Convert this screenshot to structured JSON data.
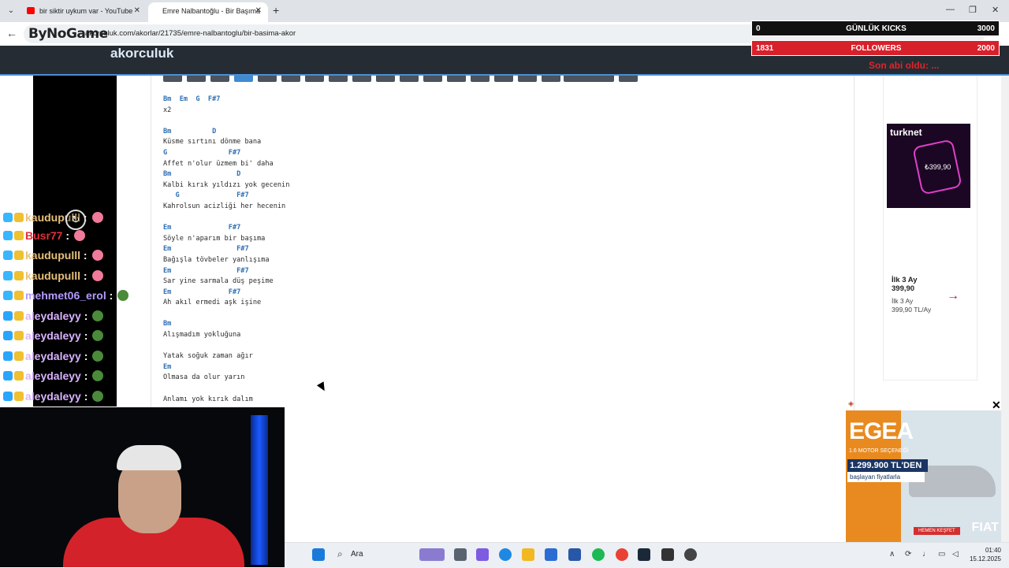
{
  "browser": {
    "tabs": [
      {
        "title": "bir siktir uykum var - YouTube",
        "favicon": "youtube-icon"
      },
      {
        "title": "Emre Nalbantoğlu - Bir Başıma",
        "favicon": "site-icon"
      }
    ],
    "url": "akorculuk.com/akorlar/21735/emre-nalbantoglu/bir-basima-akor"
  },
  "stream_logo": "ByNoGame",
  "site": {
    "name": "akorculuk",
    "accent": "#2f6fb5"
  },
  "counters": [
    {
      "left": "0",
      "label": "GÜNLÜK KICKS",
      "right": "3000",
      "color": "#111111"
    },
    {
      "left": "1831",
      "label": "FOLLOWERS",
      "right": "2000",
      "color": "#d8202b"
    }
  ],
  "overlay_text": "Son abi oldu: ...",
  "chat": [
    {
      "user": "kaudupulll",
      "color": "#e7c07a",
      "icon_color": "#38b6ff"
    },
    {
      "user": "Busr77",
      "color": "#e0303a",
      "icon_color": "#38b6ff"
    },
    {
      "user": "kaudupulll",
      "color": "#e7c07a",
      "icon_color": "#38b6ff"
    },
    {
      "user": "kaudupulll",
      "color": "#e7c07a",
      "icon_color": "#38b6ff"
    },
    {
      "user": "mehmet06_erol",
      "color": "#b49aff",
      "icon_color": "#38b6ff"
    },
    {
      "user": "aleydaleyy",
      "color": "#d9b3ff",
      "icon_color": "#2aa5ff"
    },
    {
      "user": "aleydaleyy",
      "color": "#d9b3ff",
      "icon_color": "#2aa5ff"
    },
    {
      "user": "aleydaleyy",
      "color": "#d9b3ff",
      "icon_color": "#2aa5ff"
    },
    {
      "user": "aleydaleyy",
      "color": "#d9b3ff",
      "icon_color": "#2aa5ff"
    },
    {
      "user": "aleydaleyy",
      "color": "#d9b3ff",
      "icon_color": "#2aa5ff"
    }
  ],
  "lyrics": [
    {
      "type": "chord",
      "text": "Bm  Em  G  F#7"
    },
    {
      "type": "line",
      "text": "x2"
    },
    {
      "type": "blank",
      "text": ""
    },
    {
      "type": "chord",
      "text": "Bm          D"
    },
    {
      "type": "line",
      "text": "Küsme sırtını dönme bana"
    },
    {
      "type": "chord",
      "text": "G               F#7"
    },
    {
      "type": "line",
      "text": "Affet n'olur üzmem bi' daha"
    },
    {
      "type": "chord",
      "text": "Bm                D"
    },
    {
      "type": "line",
      "text": "Kalbi kırık yıldızı yok gecenin"
    },
    {
      "type": "chord",
      "text": "   G              F#7"
    },
    {
      "type": "line",
      "text": "Kahrolsun acizliği her hecenin"
    },
    {
      "type": "blank",
      "text": ""
    },
    {
      "type": "chord",
      "text": "Em              F#7"
    },
    {
      "type": "line",
      "text": "Söyle n'aparım bir başıma"
    },
    {
      "type": "chord",
      "text": "Em                F#7"
    },
    {
      "type": "line",
      "text": "Bağışla tövbeler yanlışıma"
    },
    {
      "type": "chord",
      "text": "Em                F#7"
    },
    {
      "type": "line",
      "text": "Sar yine sarmala düş peşime"
    },
    {
      "type": "chord",
      "text": "Em              F#7"
    },
    {
      "type": "line",
      "text": "Ah akıl ermedi aşk işine"
    },
    {
      "type": "blank",
      "text": ""
    },
    {
      "type": "chord",
      "text": "Bm"
    },
    {
      "type": "line",
      "text": "Alışmadım yokluğuna"
    },
    {
      "type": "blank",
      "text": ""
    },
    {
      "type": "line",
      "text": "Yatak soğuk zaman ağır"
    },
    {
      "type": "chord",
      "text": "Em"
    },
    {
      "type": "line",
      "text": "Olmasa da olur yarın"
    },
    {
      "type": "blank",
      "text": ""
    },
    {
      "type": "line",
      "text": "Anlamı yok kırık dalım"
    }
  ],
  "side_ad": {
    "brand": "turknet",
    "price": "₺399,90",
    "title": "İlk 3 Ay\n399,90",
    "subtitle": "İlk 3 Ay\n399,90 TL/Ay"
  },
  "car_ad": {
    "model": "EGEA",
    "motor": "1.6 MOTOR SEÇENEĞİ",
    "price": "1.299.900 TL'DEN",
    "tagline": "başlayan fiyatlarla",
    "cta": "HEMEN KEŞFET",
    "brand": "FIAT"
  },
  "taskbar": {
    "search_label": "Ara",
    "time": "01:40",
    "date": "15.12.2025"
  }
}
